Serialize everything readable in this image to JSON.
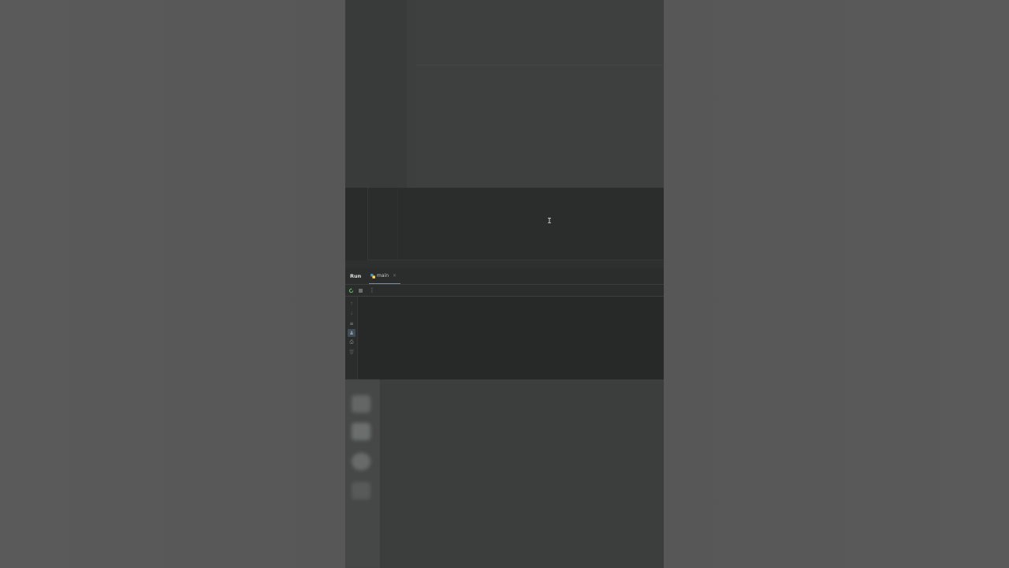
{
  "run_panel": {
    "title": "Run",
    "tabs": [
      {
        "label": "main",
        "icon": "python-icon",
        "close": "×"
      }
    ],
    "toolbar": {
      "rerun_icon": "rerun-icon",
      "stop_icon": "stop-icon",
      "more_glyph": "⋮"
    },
    "side_glyphs": {
      "up": "↑",
      "down": "↓",
      "wrap": "≡",
      "scroll": "⇊",
      "print": "⎙",
      "trash": "🗑"
    }
  },
  "editor": {
    "cursor_glyph": "I"
  },
  "colors": {
    "ide_background": "#2b2d2c",
    "console_background": "#272928",
    "rerun_green": "#5fb85f",
    "tab_underline": "#7a8a9a"
  }
}
